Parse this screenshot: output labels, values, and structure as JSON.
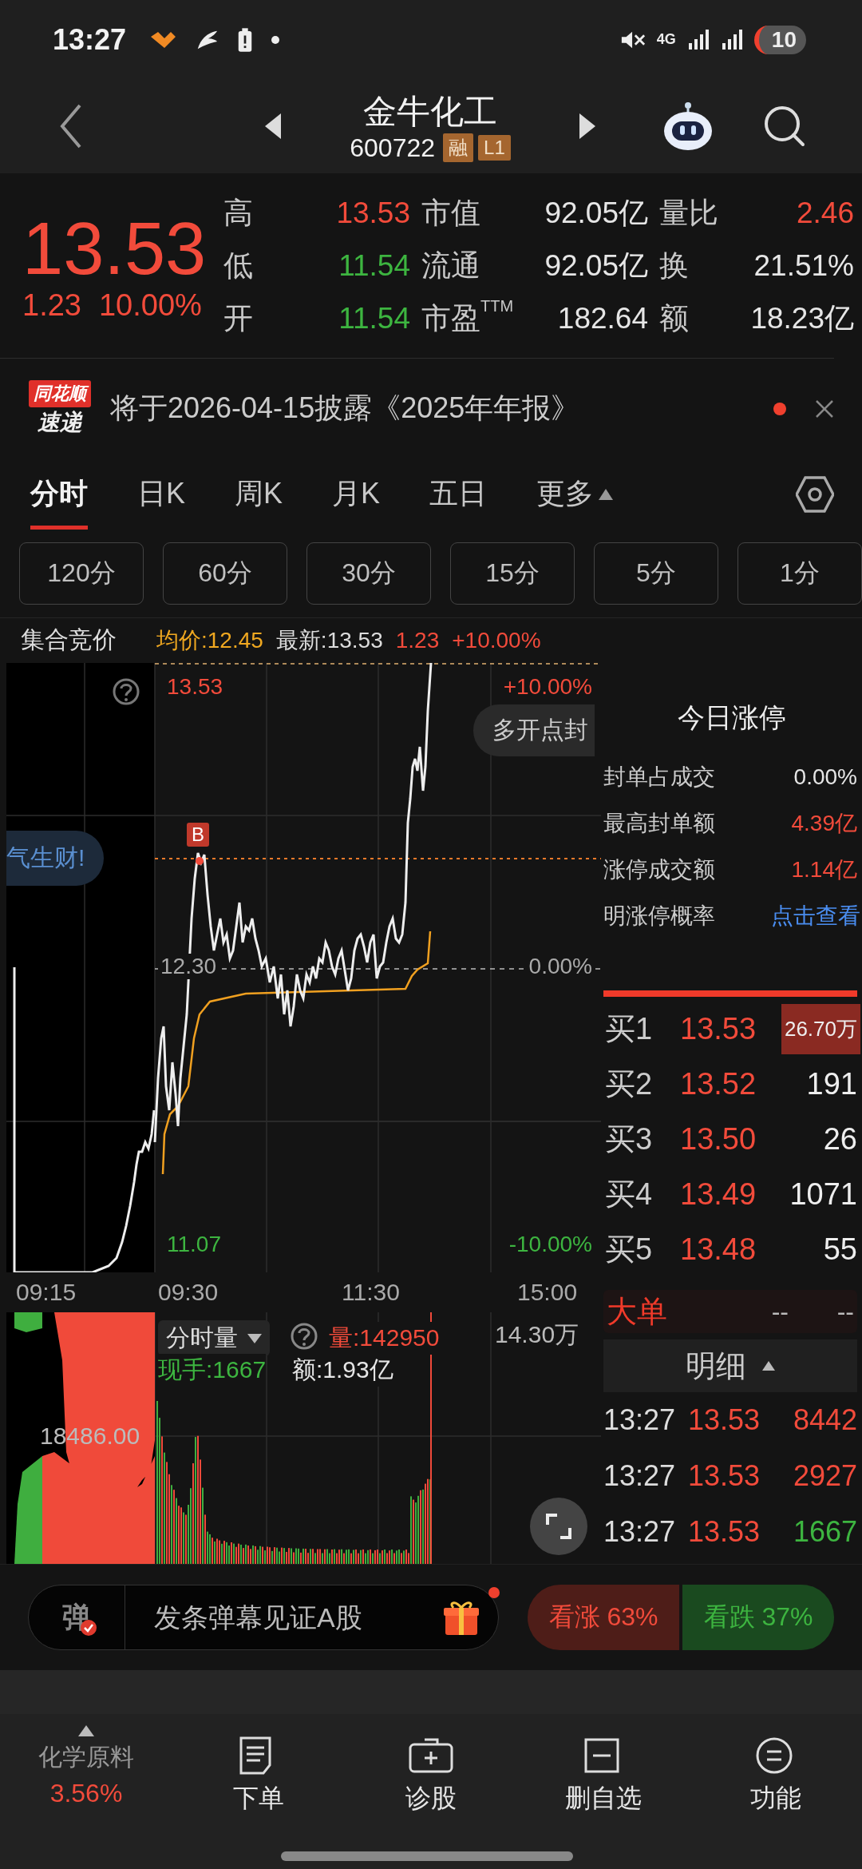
{
  "status_bar": {
    "time": "13:27",
    "network": "4G",
    "battery": "10"
  },
  "header": {
    "title": "金牛化工",
    "code": "600722",
    "badges": [
      "融",
      "L1"
    ]
  },
  "quote": {
    "price": "13.53",
    "change": "1.23",
    "change_pct": "10.00%",
    "color": "#f24b3b",
    "stats": [
      {
        "label": "高",
        "value": "13.53",
        "color": "#f24b3b"
      },
      {
        "label": "市值",
        "value": "92.05亿",
        "color": "#e6e6e6"
      },
      {
        "label": "量比",
        "value": "2.46",
        "color": "#f24b3b"
      },
      {
        "label": "低",
        "value": "11.54",
        "color": "#3db540"
      },
      {
        "label": "流通",
        "value": "92.05亿",
        "color": "#e6e6e6"
      },
      {
        "label": "换",
        "value": "21.51%",
        "color": "#e6e6e6"
      },
      {
        "label": "开",
        "value": "11.54",
        "color": "#3db540"
      },
      {
        "label": "市盈$^{TTM}$",
        "value": "182.64",
        "color": "#e6e6e6"
      },
      {
        "label": "额",
        "value": "18.23亿",
        "color": "#e6e6e6"
      }
    ]
  },
  "news": {
    "source_top": "同花顺",
    "source_bottom": "速递",
    "text": "将于2026-04-15披露《2025年年报》",
    "unread": true
  },
  "tabs": [
    {
      "label": "分时",
      "selected": true,
      "kind": "tab"
    },
    {
      "label": "日K",
      "selected": false,
      "kind": "tab"
    },
    {
      "label": "周K",
      "selected": false,
      "kind": "tab"
    },
    {
      "label": "月K",
      "selected": false,
      "kind": "tab"
    },
    {
      "label": "五日",
      "selected": false,
      "kind": "tab"
    },
    {
      "label": "更多",
      "selected": false,
      "kind": "menu"
    }
  ],
  "periods": [
    {
      "label": "120分",
      "selected": false
    },
    {
      "label": "60分",
      "selected": false
    },
    {
      "label": "30分",
      "selected": false
    },
    {
      "label": "15分",
      "selected": false
    },
    {
      "label": "5分",
      "selected": false
    },
    {
      "label": "1分",
      "selected": false
    }
  ],
  "chart_header": {
    "title": "集合竞价",
    "avg": "均价:12.45",
    "latest": "最新:13.53",
    "change": "1.23",
    "change_pct": "+10.00%"
  },
  "chart": {
    "top_price": "13.53",
    "top_pct": "+10.00%",
    "mid_price": "12.30",
    "mid_pct": "0.00%",
    "bottom_price": "11.07",
    "bottom_pct": "-10.00%",
    "marker": "B",
    "times": [
      "09:15",
      "09:30",
      "11:30",
      "15:00"
    ],
    "bubbles": [
      {
        "text": "多开点封",
        "kind": "right"
      },
      {
        "text": "气生财!",
        "kind": "left"
      }
    ]
  },
  "volume": {
    "selector": "分时量",
    "volume": "量:142950",
    "current": "现手:1667",
    "amount": "额:1.93亿",
    "max": "14.30万",
    "auction_level": "18486.00"
  },
  "limit_panel": {
    "title": "今日涨停",
    "rows": [
      {
        "label": "封单占成交",
        "value": "0.00%",
        "color": "#e6e6e6",
        "kind": "value"
      },
      {
        "label": "最高封单额",
        "value": "4.39亿",
        "color": "#f24b3b",
        "kind": "value"
      },
      {
        "label": "涨停成交额",
        "value": "1.14亿",
        "color": "#f24b3b",
        "kind": "value"
      },
      {
        "label": "明涨停概率",
        "value": "点击查看",
        "color": "#4a8df0",
        "kind": "link"
      }
    ]
  },
  "order_book": [
    {
      "label": "买1",
      "price": "13.53",
      "qty": "26.70万",
      "highlighted": true
    },
    {
      "label": "买2",
      "price": "13.52",
      "qty": "191",
      "highlighted": false
    },
    {
      "label": "买3",
      "price": "13.50",
      "qty": "26",
      "highlighted": false
    },
    {
      "label": "买4",
      "price": "13.49",
      "qty": "1071",
      "highlighted": false
    },
    {
      "label": "买5",
      "price": "13.48",
      "qty": "55",
      "highlighted": false
    }
  ],
  "big_orders": {
    "label": "大单",
    "value_1": "--",
    "value_2": "--"
  },
  "details": {
    "title": "明细",
    "trades": [
      {
        "time": "13:27",
        "price": "13.53",
        "qty": "8442",
        "color": "#f24b3b"
      },
      {
        "time": "13:27",
        "price": "13.53",
        "qty": "2927",
        "color": "#f24b3b"
      },
      {
        "time": "13:27",
        "price": "13.53",
        "qty": "1667",
        "color": "#3db540"
      }
    ]
  },
  "danmu": {
    "icon_text": "弹",
    "placeholder": "发条弹幕见证A股",
    "gift_badge": true
  },
  "sentiment": {
    "bull": "看涨 63%",
    "bear": "看跌 37%"
  },
  "bottom_nav": {
    "sector": {
      "name": "化学原料",
      "change": "3.56%"
    },
    "items": [
      {
        "label": "下单",
        "kind": "order"
      },
      {
        "label": "诊股",
        "kind": "diagnose"
      },
      {
        "label": "删自选",
        "kind": "remove"
      },
      {
        "label": "功能",
        "kind": "menu"
      }
    ]
  }
}
